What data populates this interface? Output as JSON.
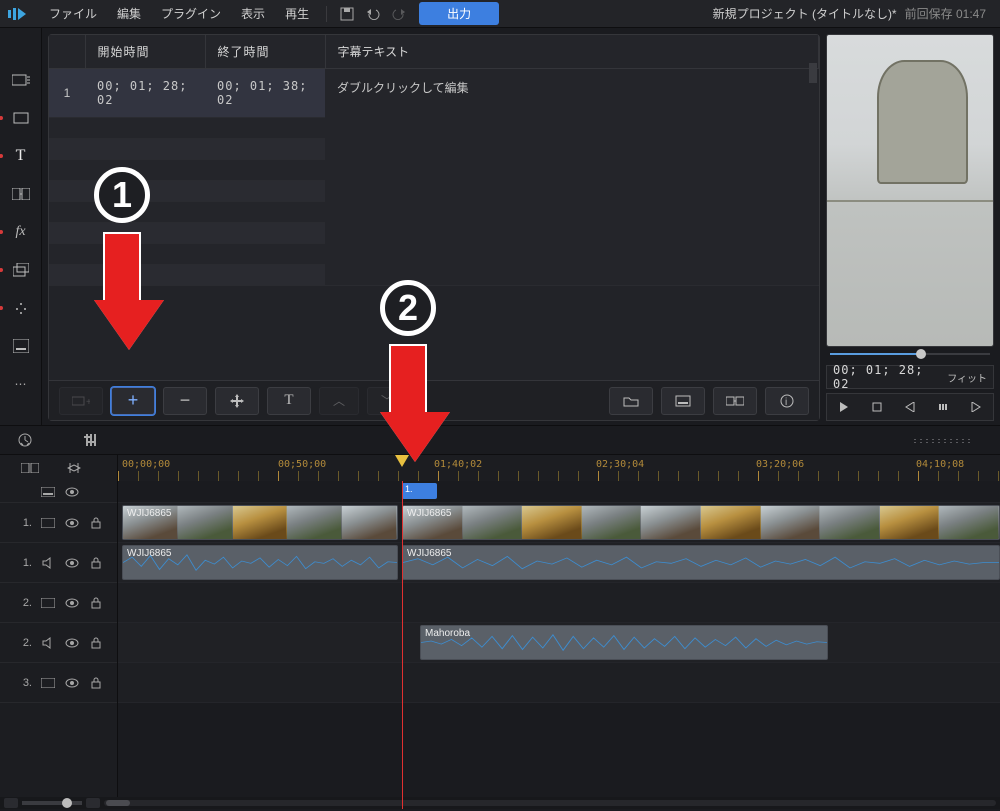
{
  "menu": {
    "file": "ファイル",
    "edit": "編集",
    "plugin": "プラグイン",
    "view": "表示",
    "play": "再生",
    "export": "出力"
  },
  "project": {
    "title": "新規プロジェクト (タイトルなし)*",
    "saved_label": "前回保存",
    "saved_time": "01:47"
  },
  "subtitle": {
    "headers": {
      "index": "",
      "start": "開始時間",
      "end": "終了時間",
      "text": "字幕テキスト"
    },
    "rows": [
      {
        "idx": "1",
        "start": "00; 01; 28; 02",
        "end": "00; 01; 38; 02",
        "text": "ダブルクリックして編集"
      }
    ]
  },
  "subtoolbar": {
    "add": "+",
    "remove": "−",
    "move": "✥",
    "text": "T",
    "up": "⌃",
    "down": "⌄",
    "folder": "folder",
    "style": "style",
    "import": "import",
    "info": "i"
  },
  "preview": {
    "timecode": "00; 01; 28; 02",
    "fit": "フィット"
  },
  "ruler": {
    "labels": [
      "00;00;00",
      "00;50;00",
      "01;40;02",
      "02;30;04",
      "03;20;06",
      "04;10;08"
    ]
  },
  "tracks": {
    "sub_clip": "1.",
    "video1_a": "WJIJ6865",
    "video1_b": "WJIJ6865",
    "audio1_a": "WJIJ6865",
    "audio1_b": "WJIJ6865",
    "audio2": "Mahoroba",
    "labels": {
      "t1": "1.",
      "t2": "2.",
      "t3": "3."
    }
  },
  "annotations": {
    "one": "1",
    "two": "2"
  }
}
